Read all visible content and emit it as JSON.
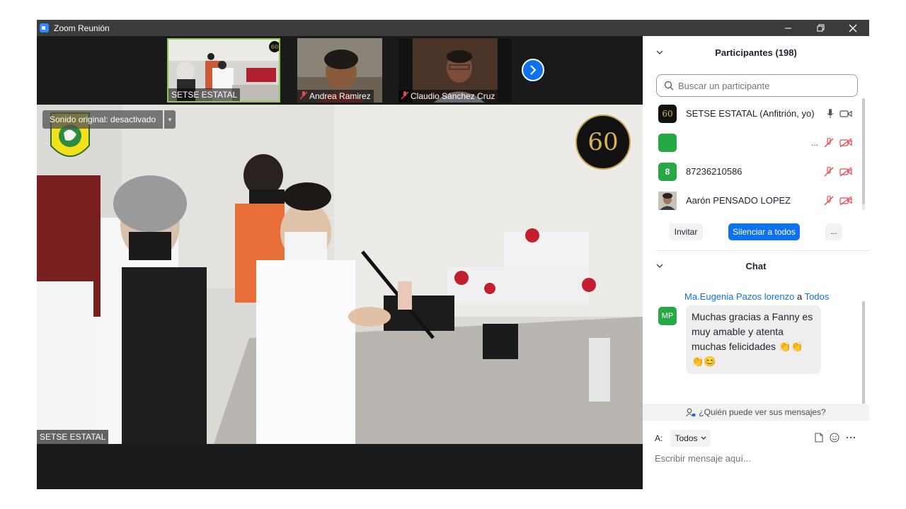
{
  "window": {
    "title": "Zoom Reunión"
  },
  "thumbnails": [
    {
      "name": "SETSE ESTATAL",
      "muted": false
    },
    {
      "name": "Andrea Ramirez",
      "muted": true
    },
    {
      "name": "Claudio Sánchez Cruz",
      "muted": true
    }
  ],
  "main_video": {
    "sound_label": "Sonido original: desactivado",
    "speaker_name": "SETSE ESTATAL",
    "badge_text": "60"
  },
  "participants": {
    "header": "Participantes (198)",
    "search_placeholder": "Buscar un participante",
    "list": [
      {
        "name": "SETSE ESTATAL (Anfitrión, yo)",
        "avatar": "60",
        "avatar_color": "#111111"
      },
      {
        "name": "",
        "avatar": "",
        "avatar_color": "#27a844",
        "ellipsis": "..."
      },
      {
        "name": "87236210586",
        "avatar": "8",
        "avatar_color": "#27a844"
      },
      {
        "name": "Aarón PENSADO LOPEZ",
        "avatar": "",
        "avatar_color": "#8a7a6a"
      }
    ],
    "invite_label": "Invitar",
    "mute_all_label": "Silenciar a todos",
    "more_label": "..."
  },
  "chat": {
    "header": "Chat",
    "message": {
      "sender": "Ma.Eugenia Pazos lorenzo",
      "to_word": "a",
      "recipient": "Todos",
      "avatar": "MP",
      "text": "Muchas gracias a Fanny es muy amable y atenta muchas felicidades 👏👏👏😊"
    },
    "visibility_label": "¿Quién puede ver sus mensajes?",
    "to_label": "A:",
    "to_value": "Todos",
    "input_placeholder": "Escribir mensaje aquí..."
  },
  "colors": {
    "accent": "#0e72ed",
    "muted_red": "#e5484d",
    "green": "#27a844"
  }
}
